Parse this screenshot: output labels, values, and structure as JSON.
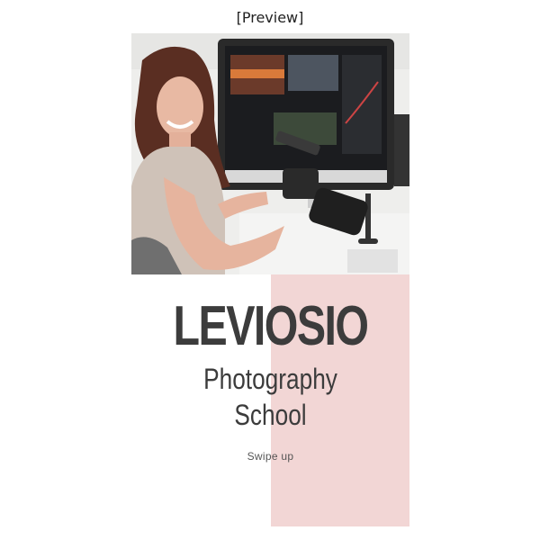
{
  "preview": {
    "label": "[Preview]"
  },
  "story": {
    "brand": "LEVIOSIO",
    "subtitle_line1": "Photography",
    "subtitle_line2": "School",
    "cta": "Swipe up"
  },
  "colors": {
    "accent_pink": "#f2d6d5",
    "text_dark": "#3c3c3c"
  },
  "photo": {
    "subject": "woman-with-camera-at-computer"
  }
}
